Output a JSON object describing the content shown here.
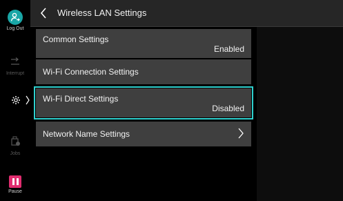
{
  "sidebar": {
    "logout_label": "Log Out",
    "interrupt_label": "Interrupt",
    "jobs_label": "Jobs",
    "pause_label": "Pause"
  },
  "header": {
    "title": "Wireless LAN Settings"
  },
  "items": [
    {
      "label": "Common Settings",
      "value": "Enabled"
    },
    {
      "label": "Wi-Fi Connection Settings"
    },
    {
      "label": "Wi-Fi Direct Settings",
      "value": "Disabled"
    },
    {
      "label": "Network Name Settings"
    }
  ],
  "colors": {
    "accent": "#19a6a6",
    "selection_border": "#2fd1cf",
    "pause": "#e02d6f",
    "item_bg": "#3f3f3f",
    "header_bg": "#262626"
  },
  "icons": {
    "logout": "person-logout-icon",
    "interrupt": "interrupt-icon",
    "settings": "gear-icon",
    "jobs": "printer-jobs-icon",
    "pause": "pause-icon",
    "back": "chevron-left-icon",
    "network_name": "chevron-right-icon"
  }
}
